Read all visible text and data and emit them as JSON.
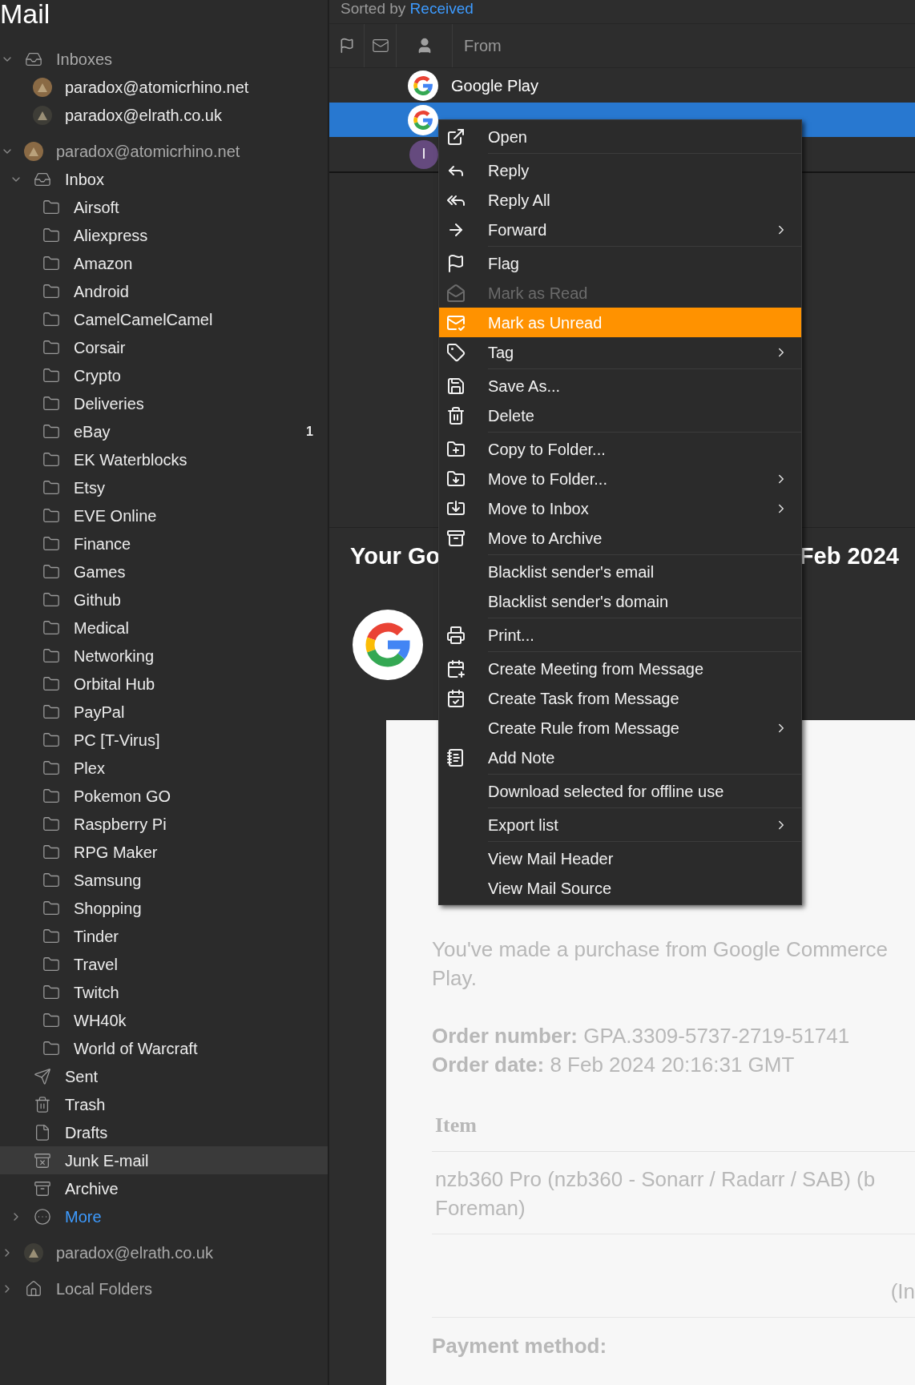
{
  "sidebar": {
    "title": "Mail",
    "tree": [
      {
        "kind": "unified",
        "label": "Inboxes",
        "expanded": true,
        "children": [
          {
            "kind": "mailbox",
            "label": "paradox@atomicrhino.net",
            "color": "#8a6a45"
          },
          {
            "kind": "mailbox",
            "label": "paradox@elrath.co.uk",
            "color": "#3e3d37"
          }
        ]
      },
      {
        "kind": "account",
        "label": "paradox@atomicrhino.net",
        "color": "#8a6a45",
        "expanded": true,
        "children": [
          {
            "kind": "inbox",
            "label": "Inbox",
            "expanded": true,
            "selected": false,
            "children": [
              {
                "kind": "folder",
                "label": "Airsoft",
                "selected": false
              },
              {
                "kind": "folder",
                "label": "Aliexpress",
                "selected": false
              },
              {
                "kind": "folder",
                "label": "Amazon",
                "selected": false
              },
              {
                "kind": "folder",
                "label": "Android",
                "selected": false
              },
              {
                "kind": "folder",
                "label": "CamelCamelCamel",
                "selected": false
              },
              {
                "kind": "folder",
                "label": "Corsair",
                "selected": false
              },
              {
                "kind": "folder",
                "label": "Crypto",
                "selected": false
              },
              {
                "kind": "folder",
                "label": "Deliveries",
                "selected": false
              },
              {
                "kind": "folder",
                "label": "eBay",
                "selected": false,
                "count": "1"
              },
              {
                "kind": "folder",
                "label": "EK Waterblocks",
                "selected": false
              },
              {
                "kind": "folder",
                "label": "Etsy",
                "selected": false
              },
              {
                "kind": "folder",
                "label": "EVE Online",
                "selected": false
              },
              {
                "kind": "folder",
                "label": "Finance",
                "selected": false
              },
              {
                "kind": "folder",
                "label": "Games",
                "selected": false
              },
              {
                "kind": "folder",
                "label": "Github",
                "selected": false
              },
              {
                "kind": "folder",
                "label": "Medical",
                "selected": false
              },
              {
                "kind": "folder",
                "label": "Networking",
                "selected": false
              },
              {
                "kind": "folder",
                "label": "Orbital Hub",
                "selected": false
              },
              {
                "kind": "folder",
                "label": "PayPal",
                "selected": false
              },
              {
                "kind": "folder",
                "label": "PC [T-Virus]",
                "selected": false
              },
              {
                "kind": "folder",
                "label": "Plex",
                "selected": false
              },
              {
                "kind": "folder",
                "label": "Pokemon GO",
                "selected": false
              },
              {
                "kind": "folder",
                "label": "Raspberry Pi",
                "selected": false
              },
              {
                "kind": "folder",
                "label": "RPG Maker",
                "selected": false
              },
              {
                "kind": "folder",
                "label": "Samsung",
                "selected": false
              },
              {
                "kind": "folder",
                "label": "Shopping",
                "selected": false
              },
              {
                "kind": "folder",
                "label": "Tinder",
                "selected": false
              },
              {
                "kind": "folder",
                "label": "Travel",
                "selected": false
              },
              {
                "kind": "folder",
                "label": "Twitch",
                "selected": false
              },
              {
                "kind": "folder",
                "label": "WH40k",
                "selected": false
              },
              {
                "kind": "folder",
                "label": "World of Warcraft",
                "selected": false
              }
            ]
          },
          {
            "kind": "sent",
            "label": "Sent",
            "selected": false
          },
          {
            "kind": "trash",
            "label": "Trash",
            "selected": false
          },
          {
            "kind": "drafts",
            "label": "Drafts",
            "selected": false
          },
          {
            "kind": "junk",
            "label": "Junk E-mail",
            "selected": true
          },
          {
            "kind": "archive",
            "label": "Archive",
            "selected": false
          },
          {
            "kind": "more",
            "label": "More",
            "expanded": false,
            "selected": false
          }
        ]
      },
      {
        "kind": "account",
        "label": "paradox@elrath.co.uk",
        "color": "#3e3d37",
        "expanded": false
      },
      {
        "kind": "local",
        "label": "Local Folders",
        "expanded": false
      }
    ]
  },
  "message_list": {
    "sorted_by_prefix": "Sorted by",
    "sorted_by": "Received",
    "from_column": "From",
    "rows": [
      {
        "kind": "google",
        "from": "Google Play",
        "selected": false
      },
      {
        "kind": "google",
        "selected": true
      },
      {
        "kind": "letter",
        "initial": "I",
        "selected": false
      }
    ]
  },
  "preview": {
    "subject_start": "Your Go",
    "subject_end": "Feb 2024",
    "intro_lines": [
      "You've made a purchase from Google Commerce",
      "Play."
    ],
    "order_number": "**Order number:** GPA.3309-5737-2719-51741",
    "order_date": "**Order date:** 8 Feb 2024 20:16:31 GMT",
    "item_heading": "Item",
    "item_lines": [
      "nzb360 Pro (nzb360 - Sonarr / Radarr / SAB) (b",
      "Foreman)"
    ],
    "total_fragment": "(In",
    "payment_label": "Payment method:"
  },
  "context_menu": {
    "groups": [
      {
        "items": [
          {
            "label": "Open",
            "disabled": false,
            "selected": false,
            "submenu": false
          }
        ]
      },
      {
        "items": [
          {
            "label": "Reply",
            "disabled": false,
            "selected": false,
            "submenu": false
          },
          {
            "label": "Reply All",
            "disabled": false,
            "selected": false,
            "submenu": false
          },
          {
            "label": "Forward",
            "disabled": false,
            "selected": false,
            "submenu": true
          }
        ]
      },
      {
        "items": [
          {
            "label": "Flag",
            "disabled": false,
            "selected": false,
            "submenu": false
          },
          {
            "label": "Mark as Read",
            "disabled": true,
            "selected": false,
            "submenu": false
          },
          {
            "label": "Mark as Unread",
            "disabled": false,
            "selected": true,
            "submenu": false
          },
          {
            "label": "Tag",
            "disabled": false,
            "selected": false,
            "submenu": true
          }
        ]
      },
      {
        "items": [
          {
            "label": "Save As...",
            "disabled": false,
            "selected": false,
            "submenu": false
          },
          {
            "label": "Delete",
            "disabled": false,
            "selected": false,
            "submenu": false
          }
        ]
      },
      {
        "items": [
          {
            "label": "Copy to Folder...",
            "disabled": false,
            "selected": false,
            "submenu": false
          },
          {
            "label": "Move to Folder...",
            "disabled": false,
            "selected": false,
            "submenu": true
          },
          {
            "label": "Move to Inbox",
            "disabled": false,
            "selected": false,
            "submenu": true
          },
          {
            "label": "Move to Archive",
            "disabled": false,
            "selected": false,
            "submenu": false
          }
        ]
      },
      {
        "items": [
          {
            "label": "Blacklist sender's email",
            "disabled": false,
            "selected": false,
            "submenu": false
          },
          {
            "label": "Blacklist sender's domain",
            "disabled": false,
            "selected": false,
            "submenu": false
          }
        ]
      },
      {
        "items": [
          {
            "label": "Print...",
            "disabled": false,
            "selected": false,
            "submenu": false
          }
        ]
      },
      {
        "items": [
          {
            "label": "Create Meeting from Message",
            "disabled": false,
            "selected": false,
            "submenu": false
          },
          {
            "label": "Create Task from Message",
            "disabled": false,
            "selected": false,
            "submenu": false
          },
          {
            "label": "Create Rule from Message",
            "disabled": false,
            "selected": false,
            "submenu": true
          },
          {
            "label": "Add Note",
            "disabled": false,
            "selected": false,
            "submenu": false
          }
        ]
      },
      {
        "items": [
          {
            "label": "Download selected for offline use",
            "disabled": false,
            "selected": false,
            "submenu": false
          }
        ]
      },
      {
        "items": [
          {
            "label": "Export list",
            "disabled": false,
            "selected": false,
            "submenu": true
          }
        ]
      },
      {
        "items": [
          {
            "label": "View Mail Header",
            "disabled": false,
            "selected": false,
            "submenu": false
          },
          {
            "label": "View Mail Source",
            "disabled": false,
            "selected": false,
            "submenu": false
          }
        ]
      }
    ]
  }
}
